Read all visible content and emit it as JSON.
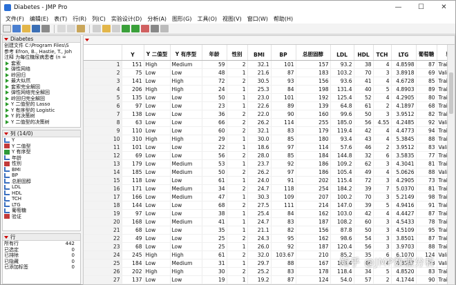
{
  "window": {
    "title": "Diabetes - JMP Pro",
    "minimize": "—",
    "maximize": "☐",
    "close": "✕"
  },
  "menu": [
    "文件(F)",
    "编辑(E)",
    "表(T)",
    "行(R)",
    "列(C)",
    "实验设计(D)",
    "分析(A)",
    "图形(G)",
    "工具(O)",
    "视图(V)",
    "窗口(W)",
    "帮助(H)"
  ],
  "table_panel": {
    "name": "Diabetes",
    "lines": [
      "创建文件 C:\\Program Files\\S",
      "参考  Efron, B., Hastie, T., Joh",
      "注释  为每位糖尿病患者 (n ="
    ],
    "scripts": [
      "套索",
      "弹性网络",
      "岭回归",
      "最大似然",
      "套索完全解回",
      "弹性网络完全解回",
      "岭回归完全解回",
      "Y 二值型的 Lasso",
      "Y 有序型的 Logistic",
      "Y 的决策树",
      "Y 二值型的决策树"
    ]
  },
  "columns_panel": {
    "header": "列 (14/0)",
    "items": [
      "Y",
      "Y 二值型",
      "Y 有序型",
      "年龄",
      "性别",
      "BMI",
      "BP",
      "总胆固醇",
      "LDL",
      "HDL",
      "TCH",
      "LTG",
      "葡萄糖",
      "验证"
    ]
  },
  "rows_panel": {
    "header": "行",
    "stats": [
      {
        "label": "所有行",
        "value": "442"
      },
      {
        "label": "已选定",
        "value": "0"
      },
      {
        "label": "已排除",
        "value": "0"
      },
      {
        "label": "已隐藏",
        "value": "0"
      },
      {
        "label": "已添加标签",
        "value": "0"
      }
    ]
  },
  "grid": {
    "headers": [
      "",
      "Y",
      "Y 二值型",
      "Y 有序型",
      "年龄",
      "性别",
      "BMI",
      "BP",
      "总胆固醇",
      "LDL",
      "HDL",
      "TCH",
      "LTG",
      "葡萄糖",
      "验证"
    ],
    "rows": [
      [
        "1",
        "151",
        "High",
        "Medium",
        "59",
        "2",
        "32.1",
        "101",
        "157",
        "93.2",
        "38",
        "4",
        "4.8598",
        "87",
        "Training"
      ],
      [
        "2",
        "75",
        "Low",
        "Low",
        "48",
        "1",
        "21.6",
        "87",
        "183",
        "103.2",
        "70",
        "3",
        "3.8918",
        "69",
        "Validatic"
      ],
      [
        "3",
        "141",
        "Low",
        "High",
        "72",
        "2",
        "30.5",
        "93",
        "156",
        "93.6",
        "41",
        "4",
        "4.6728",
        "85",
        "Training"
      ],
      [
        "4",
        "206",
        "High",
        "High",
        "24",
        "1",
        "25.3",
        "84",
        "198",
        "131.4",
        "40",
        "5",
        "4.8903",
        "89",
        "Training"
      ],
      [
        "5",
        "135",
        "Low",
        "Low",
        "50",
        "1",
        "23.0",
        "101",
        "192",
        "125.4",
        "52",
        "4",
        "4.2905",
        "80",
        "Training"
      ],
      [
        "6",
        "97",
        "Low",
        "Low",
        "23",
        "1",
        "22.6",
        "89",
        "139",
        "64.8",
        "61",
        "2",
        "4.1897",
        "68",
        "Training"
      ],
      [
        "7",
        "138",
        "Low",
        "Low",
        "36",
        "2",
        "22.0",
        "90",
        "160",
        "99.6",
        "50",
        "3",
        "3.9512",
        "82",
        "Training"
      ],
      [
        "8",
        "63",
        "Low",
        "Low",
        "66",
        "2",
        "26.2",
        "114",
        "255",
        "185.0",
        "56",
        "4.55",
        "4.2485",
        "92",
        "Validatic"
      ],
      [
        "9",
        "110",
        "Low",
        "Low",
        "60",
        "2",
        "32.1",
        "83",
        "179",
        "119.4",
        "42",
        "4",
        "4.4773",
        "94",
        "Training"
      ],
      [
        "10",
        "310",
        "High",
        "High",
        "29",
        "1",
        "30.0",
        "85",
        "180",
        "93.4",
        "43",
        "4",
        "5.3845",
        "88",
        "Training"
      ],
      [
        "11",
        "101",
        "Low",
        "Low",
        "22",
        "1",
        "18.6",
        "97",
        "114",
        "57.6",
        "46",
        "2",
        "3.9512",
        "83",
        "Validatic"
      ],
      [
        "12",
        "69",
        "Low",
        "Low",
        "56",
        "2",
        "28.0",
        "85",
        "184",
        "144.8",
        "32",
        "6",
        "3.5835",
        "77",
        "Training"
      ],
      [
        "13",
        "179",
        "Low",
        "Medium",
        "53",
        "1",
        "23.7",
        "92",
        "186",
        "109.2",
        "62",
        "3",
        "4.3041",
        "81",
        "Training"
      ],
      [
        "14",
        "185",
        "Low",
        "Medium",
        "50",
        "2",
        "26.2",
        "97",
        "186",
        "105.4",
        "49",
        "4",
        "5.0626",
        "88",
        "Validatic"
      ],
      [
        "15",
        "118",
        "Low",
        "Low",
        "61",
        "1",
        "24.0",
        "91",
        "202",
        "115.4",
        "72",
        "3",
        "4.2905",
        "73",
        "Training"
      ],
      [
        "16",
        "171",
        "Low",
        "Medium",
        "34",
        "2",
        "24.7",
        "118",
        "254",
        "184.2",
        "39",
        "7",
        "5.0370",
        "81",
        "Training"
      ],
      [
        "17",
        "166",
        "Low",
        "Medium",
        "47",
        "1",
        "30.3",
        "109",
        "207",
        "100.2",
        "70",
        "3",
        "5.2149",
        "98",
        "Training"
      ],
      [
        "18",
        "144",
        "Low",
        "Low",
        "68",
        "2",
        "27.5",
        "111",
        "214",
        "147.0",
        "39",
        "5",
        "4.9416",
        "91",
        "Training"
      ],
      [
        "19",
        "97",
        "Low",
        "Low",
        "38",
        "1",
        "25.4",
        "84",
        "162",
        "103.0",
        "42",
        "4",
        "4.4427",
        "87",
        "Training"
      ],
      [
        "20",
        "168",
        "Low",
        "Medium",
        "41",
        "1",
        "24.7",
        "83",
        "187",
        "108.2",
        "60",
        "3",
        "4.5433",
        "78",
        "Training"
      ],
      [
        "21",
        "68",
        "Low",
        "Low",
        "35",
        "1",
        "21.1",
        "82",
        "156",
        "87.8",
        "50",
        "3",
        "4.5109",
        "95",
        "Training"
      ],
      [
        "22",
        "49",
        "Low",
        "Low",
        "25",
        "2",
        "24.3",
        "95",
        "162",
        "98.6",
        "54",
        "3",
        "3.8501",
        "87",
        "Training"
      ],
      [
        "23",
        "68",
        "Low",
        "Low",
        "25",
        "1",
        "26.0",
        "92",
        "187",
        "120.4",
        "56",
        "3",
        "3.9703",
        "88",
        "Training"
      ],
      [
        "24",
        "245",
        "High",
        "High",
        "61",
        "2",
        "32.0",
        "103.67",
        "210",
        "85.2",
        "35",
        "6",
        "6.1070",
        "124",
        "Validatic"
      ],
      [
        "25",
        "184",
        "Low",
        "Medium",
        "31",
        "1",
        "29.7",
        "88",
        "167",
        "103.4",
        "48",
        "4",
        "4.3567",
        "78",
        "Validatic"
      ],
      [
        "26",
        "202",
        "High",
        "High",
        "30",
        "2",
        "25.2",
        "83",
        "178",
        "118.4",
        "34",
        "5",
        "4.8520",
        "83",
        "Training"
      ],
      [
        "27",
        "137",
        "Low",
        "Low",
        "19",
        "1",
        "19.2",
        "87",
        "124",
        "54.0",
        "57",
        "2",
        "4.1744",
        "90",
        "Training"
      ]
    ]
  },
  "watermark": "知乎 @JMP数据分析"
}
